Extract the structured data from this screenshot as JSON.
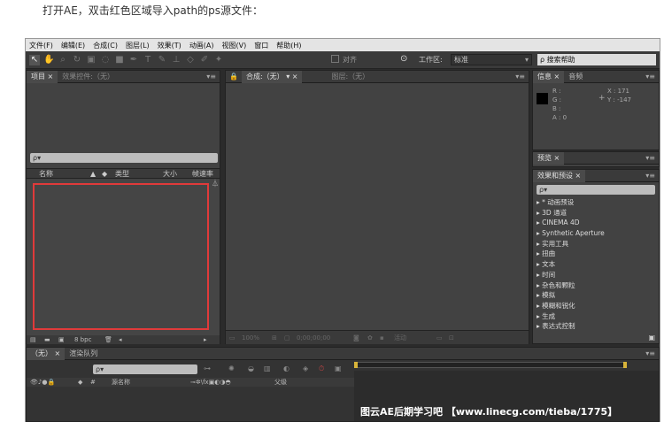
{
  "caption": "打开AE，双击红色区域导入path的ps源文件：",
  "menu": [
    "文件(F)",
    "编辑(E)",
    "合成(C)",
    "图层(L)",
    "效果(T)",
    "动画(A)",
    "视图(V)",
    "窗口",
    "帮助(H)"
  ],
  "toolbar": {
    "align_label": "对齐",
    "workspace_label": "工作区:",
    "workspace_value": "标准",
    "search_help": "搜索帮助"
  },
  "project_panel": {
    "tabs": [
      "项目",
      "效果控件:（无）"
    ],
    "search": "ρ▾",
    "columns": [
      "名称",
      "类型",
      "大小",
      "帧速率"
    ],
    "bpc": "8 bpc"
  },
  "composition_panel": {
    "tabs": [
      "合成:（无）",
      "图层:（无）"
    ],
    "zoom": "100%",
    "timecode": "0;00;00;00",
    "view": "活动"
  },
  "info_panel": {
    "tabs": [
      "信息",
      "音频"
    ],
    "r": "R :",
    "g": "G :",
    "b": "B :",
    "a": "A : 0",
    "x": "X : 171",
    "y": "Y : -147"
  },
  "preview_panel": {
    "tab": "预览"
  },
  "effects_panel": {
    "tab": "效果和预设",
    "search": "ρ▾",
    "items": [
      "* 动画预设",
      "3D 通道",
      "CINEMA 4D",
      "Synthetic Aperture",
      "实用工具",
      "扭曲",
      "文本",
      "时间",
      "杂色和颗粒",
      "模拟",
      "模糊和锐化",
      "生成",
      "表达式控制"
    ]
  },
  "timeline": {
    "tabs": [
      "（无）",
      "渲染队列"
    ],
    "search": "ρ▾",
    "columns": [
      "#",
      "源名称",
      "父级"
    ]
  },
  "watermark": "图云AE后期学习吧 【www.linecg.com/tieba/1775】"
}
